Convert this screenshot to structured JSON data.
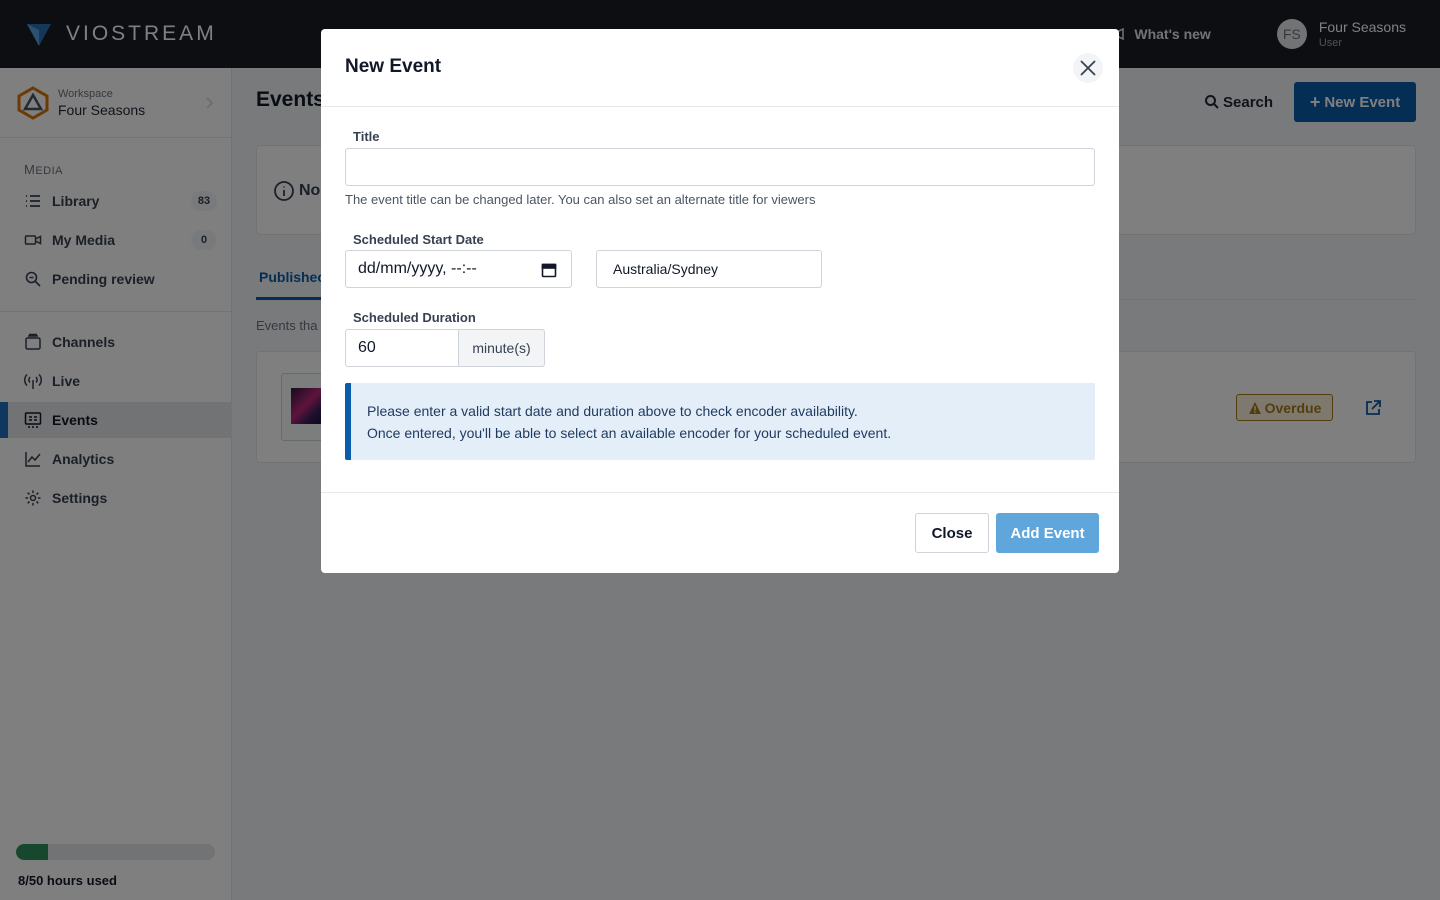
{
  "topbar": {
    "brand_name": "VIOSTREAM",
    "whats_new_label": "What's new",
    "user": {
      "initials": "FS",
      "name": "Four Seasons",
      "role": "User"
    }
  },
  "sidebar": {
    "workspace_label": "Workspace",
    "workspace_name": "Four Seasons",
    "section_media_first": "M",
    "section_media_rest": "EDIA",
    "items": [
      {
        "label": "Library",
        "icon": "list-icon",
        "count": "83"
      },
      {
        "label": "My Media",
        "icon": "camera-icon",
        "count": "0"
      },
      {
        "label": "Pending review",
        "icon": "search-icon"
      },
      {
        "label": "Channels",
        "icon": "channels-icon"
      },
      {
        "label": "Live",
        "icon": "broadcast-icon"
      },
      {
        "label": "Events",
        "icon": "events-icon",
        "active": true
      },
      {
        "label": "Analytics",
        "icon": "chart-icon"
      },
      {
        "label": "Settings",
        "icon": "gear-icon"
      }
    ],
    "usage": {
      "text": "8/50 hours used",
      "used": 8,
      "total": 50
    }
  },
  "main": {
    "page_title": "Events",
    "search_label": "Search",
    "new_event_label": "New Event",
    "notice_text": "No",
    "tab_label": "Publishec",
    "events_desc": "Events tha",
    "event_status": "Overdue"
  },
  "modal": {
    "title": "New Event",
    "title_label": "Title",
    "title_value": "",
    "title_help": "The event title can be changed later. You can also set an alternate title for viewers",
    "start_date_label": "Scheduled Start Date",
    "start_date_placeholder": "dd/mm/yyyy, --:--",
    "timezone": "Australia/Sydney",
    "duration_label": "Scheduled Duration",
    "duration_value": "60",
    "duration_unit": "minute(s)",
    "alert_line1": "Please enter a valid start date and duration above to check encoder availability.",
    "alert_line2": "Once entered, you'll be able to select an available encoder for your scheduled event.",
    "close_label": "Close",
    "add_label": "Add Event"
  },
  "colors": {
    "accent": "#0b5cab",
    "topbar": "#1a1d23",
    "overdue": "#a97a18",
    "usage_fill": "#2f8f5a",
    "add_button": "#5ea6dc"
  }
}
